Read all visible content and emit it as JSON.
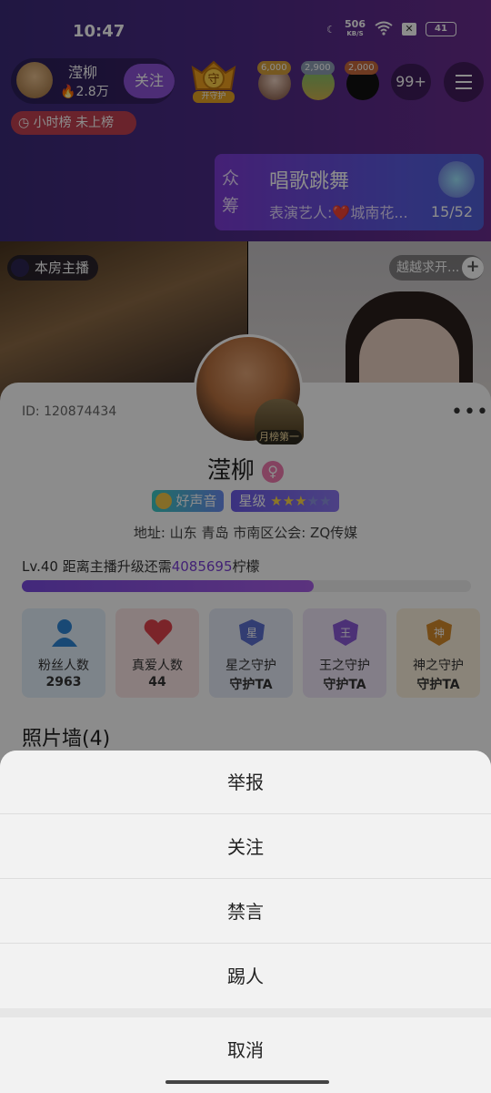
{
  "status_bar": {
    "time": "10:47",
    "net_speed": "506",
    "net_unit": "KB/S",
    "battery": "41"
  },
  "header": {
    "anchor_name": "滢柳",
    "heat": "2.8万",
    "follow_label": "关注",
    "guard_label": "开守护",
    "viewers": [
      {
        "badge": "6,000"
      },
      {
        "badge": "2,900"
      },
      {
        "badge": "2,000"
      }
    ],
    "viewer_count": "99+"
  },
  "rank": {
    "label": "小时榜 未上榜"
  },
  "crowdfund": {
    "side": "众筹",
    "title": "唱歌跳舞",
    "subtitle": "表演艺人:❤️城南花...",
    "progress": "15/52"
  },
  "video": {
    "left_tag": "本房主播",
    "right_tag": "越越求开..."
  },
  "profile": {
    "id": "ID: 120874434",
    "avatar_badge": "月榜第一",
    "name": "滢柳",
    "badge_voice": "好声音",
    "badge_star": "星级",
    "address": "地址: 山东 青岛 市南区公会:  ZQ传媒",
    "level_prefix": "Lv.40 距离主播升级还需",
    "level_amount": "4085695",
    "level_suffix": "柠檬",
    "level_progress": 0.65,
    "tiles": [
      {
        "label": "粉丝人数",
        "value": "2963",
        "icon": "person-icon",
        "color": "#2f86d6"
      },
      {
        "label": "真爱人数",
        "value": "44",
        "icon": "heart-icon",
        "color": "#e0434c"
      },
      {
        "label": "星之守护",
        "value": "守护TA",
        "icon": "star-guard-icon",
        "color": "#5b6fcf"
      },
      {
        "label": "王之守护",
        "value": "守护TA",
        "icon": "king-guard-icon",
        "color": "#8a5ad8"
      },
      {
        "label": "神之守护",
        "value": "守护TA",
        "icon": "god-guard-icon",
        "color": "#d68a2a"
      }
    ],
    "photo_wall": "照片墙(4)"
  },
  "sheet": {
    "report": "举报",
    "follow": "关注",
    "mute": "禁言",
    "kick": "踢人",
    "cancel": "取消"
  }
}
